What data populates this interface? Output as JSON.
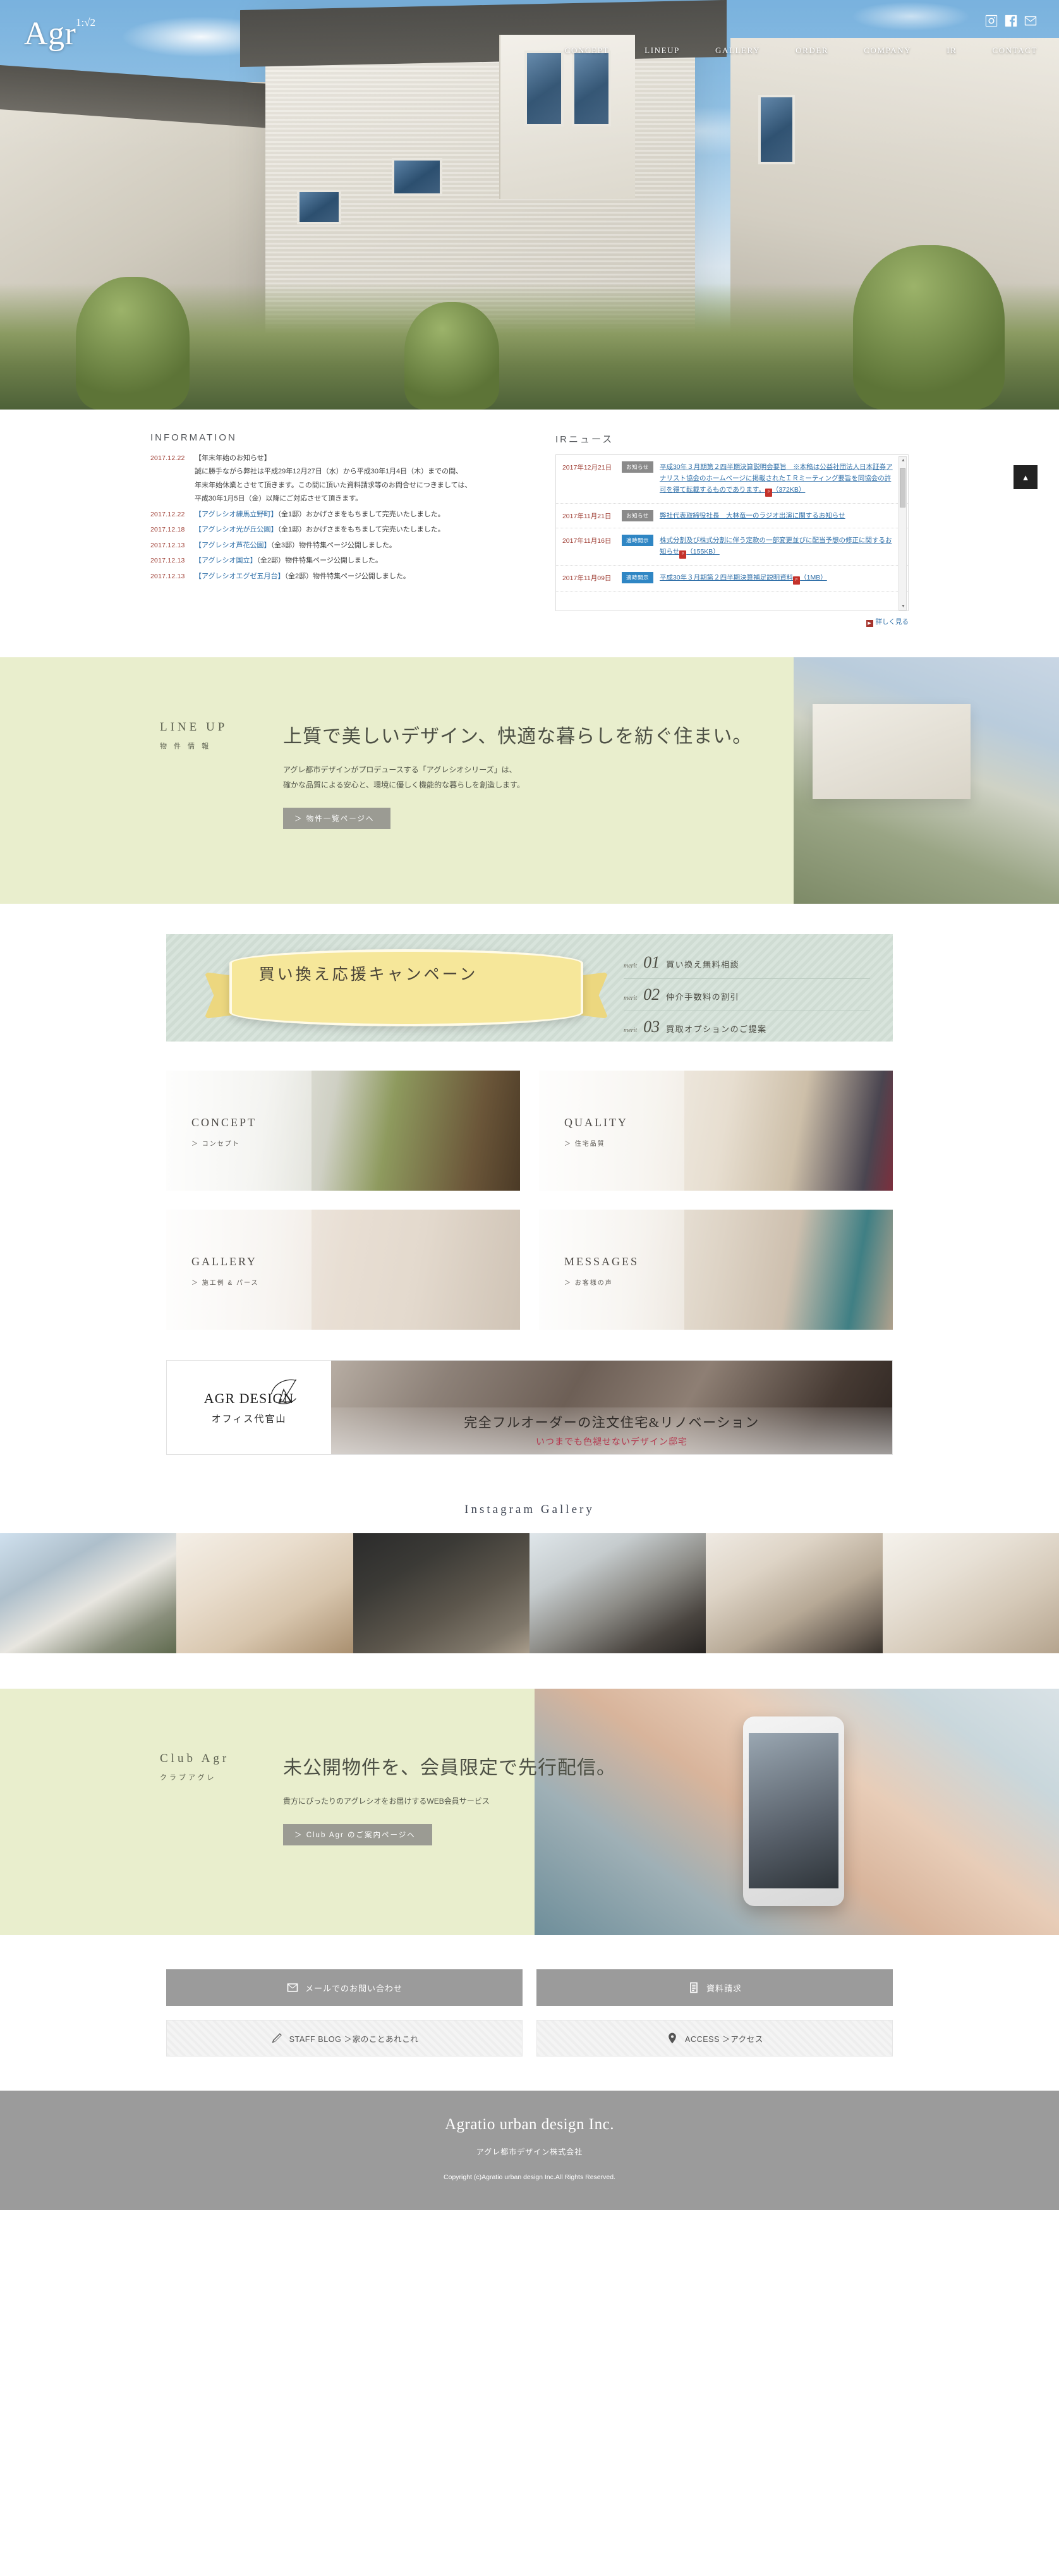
{
  "site": {
    "logo_main": "Agr",
    "logo_sup": "1:√2"
  },
  "social": [
    {
      "name": "instagram-icon",
      "label": "Instagram"
    },
    {
      "name": "facebook-icon",
      "label": "Facebook"
    },
    {
      "name": "mail-icon",
      "label": "Mail"
    }
  ],
  "nav": [
    {
      "label": "CONCEPT"
    },
    {
      "label": "LINEUP"
    },
    {
      "label": "GALLERY"
    },
    {
      "label": "ORDER"
    },
    {
      "label": "COMPANY"
    },
    {
      "label": "IR"
    },
    {
      "label": "CONTACT"
    }
  ],
  "information": {
    "heading": "INFORMATION",
    "items": [
      {
        "date": "2017.12.22",
        "title": "【年末年始のお知らせ】",
        "lines": [
          "誠に勝手ながら弊社は平成29年12月27日（水）から平成30年1月4日（木）までの間、",
          "年末年始休業とさせて頂きます。この間に頂いた資料請求等のお問合せにつきましては、",
          "平成30年1月5日（金）以降にご対応させて頂きます。"
        ]
      },
      {
        "date": "2017.12.22",
        "link": "【アグレシオ練馬立野町】",
        "text": "（全1邸）おかげさまをもちまして完売いたしました。"
      },
      {
        "date": "2017.12.18",
        "link": "【アグレシオ光が丘公園】",
        "text": "（全1邸）おかげさまをもちまして完売いたしました。"
      },
      {
        "date": "2017.12.13",
        "link": "【アグレシオ芦花公園】",
        "text": "（全3邸）物件特集ページ公開しました。"
      },
      {
        "date": "2017.12.13",
        "link": "【アグレシオ国立】",
        "text": "（全2邸）物件特集ページ公開しました。"
      },
      {
        "date": "2017.12.13",
        "link": "【アグレシオエグゼ五月台】",
        "text": "（全2邸）物件特集ページ公開しました。"
      }
    ]
  },
  "ir_news": {
    "heading": "IRニュース",
    "more_label": "詳しく見る",
    "items": [
      {
        "date": "2017年12月21日",
        "badge": "お知らせ",
        "badge_type": "notice",
        "text": "平成30年３月期第２四半期決算説明会要旨　※本稿は公益社団法人日本証券アナリスト協会のホームページに掲載されたＩＲミーティング要旨を同協会の許可を得て転載するものであります。",
        "size": "（372KB）"
      },
      {
        "date": "2017年11月21日",
        "badge": "お知らせ",
        "badge_type": "notice",
        "text": "弊社代表取締役社長　大林竜一のラジオ出演に関するお知らせ",
        "size": ""
      },
      {
        "date": "2017年11月16日",
        "badge": "適時開示",
        "badge_type": "disc",
        "text": "株式分割及び株式分割に伴う定款の一部変更並びに配当予想の修正に関するお知らせ",
        "size": "（155KB）"
      },
      {
        "date": "2017年11月09日",
        "badge": "適時開示",
        "badge_type": "disc",
        "text": "平成30年３月期第２四半期決算補足説明資料",
        "size": "（1MB）"
      }
    ]
  },
  "scroll_top": {
    "label": "▲"
  },
  "lineup": {
    "en": "LINE UP",
    "jp": "物 件 情 報",
    "headline": "上質で美しいデザイン、快適な暮らしを紡ぐ住まい。",
    "desc1": "アグレ都市デザインがプロデュースする「アグレシオシリーズ」は、",
    "desc2": "確かな品質による安心と、環境に優しく機能的な暮らしを創造します。",
    "button": "＞ 物件一覧ページへ"
  },
  "campaign": {
    "ribbon_text": "買い換え応援キャンペーン",
    "merits": [
      {
        "label": "merit",
        "num": "01",
        "text": "買い換え無料相談"
      },
      {
        "label": "merit",
        "num": "02",
        "text": "仲介手数料の割引"
      },
      {
        "label": "merit",
        "num": "03",
        "text": "買取オプションのご提案"
      }
    ]
  },
  "cards": [
    {
      "en": "CONCEPT",
      "jp": "＞ コンセプト"
    },
    {
      "en": "QUALITY",
      "jp": "＞ 住宅品質"
    },
    {
      "en": "GALLERY",
      "jp": "＞ 施工例 & パース"
    },
    {
      "en": "MESSAGES",
      "jp": "＞ お客様の声"
    }
  ],
  "agr_design": {
    "name": "AGR DESIGN",
    "sub": "オフィス代官山",
    "caption": "完全フルオーダーの注文住宅&リノベーション",
    "subcaption": "いつまでも色褪せないデザイン邸宅"
  },
  "instagram": {
    "heading": "Instagram Gallery",
    "cells": 6
  },
  "club": {
    "en": "Club Agr",
    "jp": "クラブアグレ",
    "headline": "未公開物件を、会員限定で先行配信。",
    "desc": "貴方にぴったりのアグレシオをお届けするWEB会員サービス",
    "button": "＞ Club Agr のご案内ページへ"
  },
  "contacts": [
    {
      "name": "mail-contact-button",
      "icon": "mail-icon",
      "label": "メールでのお問い合わせ",
      "style": "solid"
    },
    {
      "name": "brochure-button",
      "icon": "document-icon",
      "label": "資料請求",
      "style": "solid"
    },
    {
      "name": "staff-blog-button",
      "icon": "pen-icon",
      "label": "STAFF BLOG ＞家のことあれこれ",
      "style": "light"
    },
    {
      "name": "access-button",
      "icon": "pin-icon",
      "label": "ACCESS ＞アクセス",
      "style": "light"
    }
  ],
  "footer": {
    "name": "Agratio urban design Inc.",
    "jp": "アグレ都市デザイン株式会社",
    "copyright": "Copyright (c)Agratio urban design Inc.All Rights Reserved."
  },
  "colors": {
    "accent_green": "#e9eecd",
    "link_blue": "#2f6fa8",
    "date_red": "#9e3d33",
    "gray_button": "#9b9b9b",
    "badge_blue": "#2f86c4",
    "badge_gray": "#8a8a8a"
  }
}
